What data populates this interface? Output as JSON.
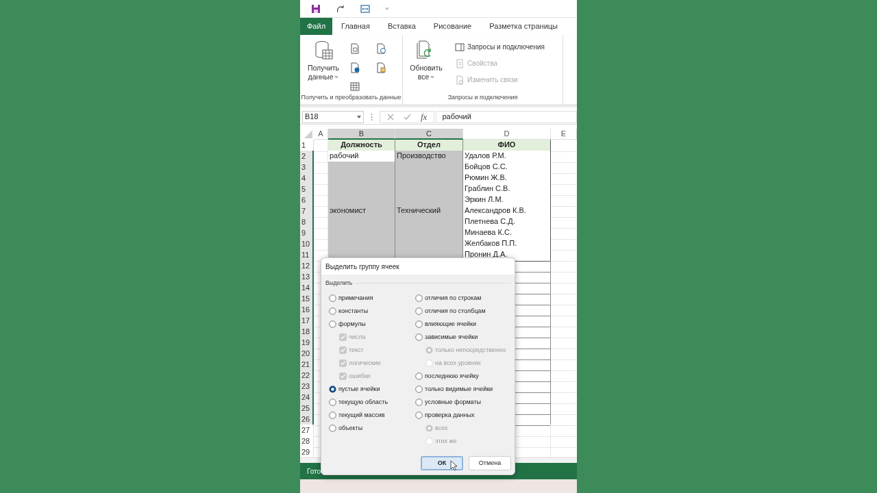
{
  "ribbon_tabs": [
    {
      "label": "Файл",
      "kind": "file"
    },
    {
      "label": "Главная",
      "kind": "tab"
    },
    {
      "label": "Вставка",
      "kind": "tab"
    },
    {
      "label": "Рисование",
      "kind": "tab"
    },
    {
      "label": "Разметка страницы",
      "kind": "tab"
    }
  ],
  "ribbon_groups": [
    {
      "label": "Получить и преобразовать данные",
      "big_button": [
        "Получить",
        "данные"
      ],
      "kind": "icons"
    },
    {
      "label": "Запросы и подключения",
      "big_button": [
        "Обновить",
        "все"
      ],
      "kind": "commands",
      "items": [
        {
          "label": "Запросы и подключения",
          "disabled": false
        },
        {
          "label": "Свойства",
          "disabled": true
        },
        {
          "label": "Изменить связи",
          "disabled": true
        }
      ]
    }
  ],
  "formula_bar": {
    "name_box": "B18",
    "fx": "fx",
    "value": "рабочий"
  },
  "sheet": {
    "columns": [
      {
        "label": "A",
        "highlighted": false
      },
      {
        "label": "B",
        "highlighted": true
      },
      {
        "label": "C",
        "highlighted": true
      },
      {
        "label": "D",
        "highlighted": false
      },
      {
        "label": "E",
        "highlighted": false
      }
    ],
    "rows": [
      {
        "number": "1",
        "highlighted": false,
        "cells": [
          {
            "text": "Должность",
            "kind": "header"
          },
          {
            "text": "Отдел",
            "kind": "header"
          },
          {
            "text": "ФИО",
            "kind": "header"
          }
        ]
      },
      {
        "number": "2",
        "highlighted": true,
        "cells": [
          {
            "text": "рабочий",
            "selected": false
          },
          {
            "text": "Производство",
            "selected": true
          },
          {
            "text": "Удалов Р.М.",
            "selected": false
          }
        ]
      },
      {
        "number": "3",
        "highlighted": true,
        "cells": [
          {
            "selected": true
          },
          {
            "selected": true
          },
          {
            "text": "Бойцов С.С.",
            "selected": false
          }
        ]
      },
      {
        "number": "4",
        "highlighted": true,
        "cells": [
          {
            "selected": true
          },
          {
            "selected": true
          },
          {
            "text": "Рюмин Ж.В.",
            "selected": false
          }
        ]
      },
      {
        "number": "5",
        "highlighted": true,
        "cells": [
          {
            "selected": true
          },
          {
            "selected": true
          },
          {
            "text": "Граблин С.В.",
            "selected": false
          }
        ]
      },
      {
        "number": "6",
        "highlighted": true,
        "cells": [
          {
            "selected": true
          },
          {
            "selected": true
          },
          {
            "text": "Эркин Л.М.",
            "selected": false
          }
        ]
      },
      {
        "number": "7",
        "highlighted": true,
        "cells": [
          {
            "text": "экономист",
            "selected": true
          },
          {
            "text": "Технический",
            "selected": true
          },
          {
            "text": "Александров К.В.",
            "selected": false
          }
        ]
      },
      {
        "number": "8",
        "highlighted": true,
        "cells": [
          {
            "selected": true
          },
          {
            "selected": true
          },
          {
            "text": "Плетнева С.Д.",
            "selected": false
          }
        ]
      },
      {
        "number": "9",
        "highlighted": true,
        "cells": [
          {
            "selected": true
          },
          {
            "selected": true
          },
          {
            "text": "Минаева К.С.",
            "selected": false
          }
        ]
      },
      {
        "number": "10",
        "highlighted": true,
        "cells": [
          {
            "selected": true
          },
          {
            "selected": true
          },
          {
            "text": "Желбаков П.П.",
            "selected": false
          }
        ]
      },
      {
        "number": "11",
        "highlighted": true,
        "cells": [
          {
            "selected": true
          },
          {
            "selected": true
          },
          {
            "text": "Пронин Д.А.",
            "selected": false
          }
        ]
      },
      {
        "number": "12",
        "highlighted": true
      },
      {
        "number": "13",
        "highlighted": true
      },
      {
        "number": "14",
        "highlighted": true
      },
      {
        "number": "15",
        "highlighted": true
      },
      {
        "number": "16",
        "highlighted": true
      },
      {
        "number": "17",
        "highlighted": true
      },
      {
        "number": "18",
        "highlighted": true
      },
      {
        "number": "19",
        "highlighted": true
      },
      {
        "number": "20",
        "highlighted": true
      },
      {
        "number": "21",
        "highlighted": true
      },
      {
        "number": "22",
        "highlighted": true
      },
      {
        "number": "23",
        "highlighted": true
      },
      {
        "number": "24",
        "highlighted": true
      },
      {
        "number": "25",
        "highlighted": true
      },
      {
        "number": "26",
        "highlighted": true
      },
      {
        "number": "27",
        "highlighted": false
      },
      {
        "number": "28",
        "highlighted": false
      },
      {
        "number": "29",
        "highlighted": false
      }
    ]
  },
  "status_bar": {
    "text": "Гото"
  },
  "dialog": {
    "title": "Выделить группу ячеек",
    "section": "Выделить",
    "left_options": [
      {
        "label": "примечания",
        "kind": "radio",
        "selected": false,
        "disabled": false
      },
      {
        "label": "константы",
        "kind": "radio",
        "selected": false,
        "disabled": false
      },
      {
        "label": "формулы",
        "kind": "radio",
        "selected": false,
        "disabled": false,
        "children": [
          {
            "label": "числа",
            "kind": "checkbox",
            "checked": true,
            "disabled": true
          },
          {
            "label": "текст",
            "kind": "checkbox",
            "checked": true,
            "disabled": true
          },
          {
            "label": "логические",
            "kind": "checkbox",
            "checked": true,
            "disabled": true
          },
          {
            "label": "ошибки",
            "kind": "checkbox",
            "checked": true,
            "disabled": true
          }
        ]
      },
      {
        "label": "пустые ячейки",
        "kind": "radio",
        "selected": true,
        "disabled": false
      },
      {
        "label": "текущую область",
        "kind": "radio",
        "selected": false,
        "disabled": false
      },
      {
        "label": "текущий массив",
        "kind": "radio",
        "selected": false,
        "disabled": false
      },
      {
        "label": "объекты",
        "kind": "radio",
        "selected": false,
        "disabled": false
      }
    ],
    "right_options": [
      {
        "label": "отличия по строкам",
        "kind": "radio",
        "selected": false,
        "disabled": false
      },
      {
        "label": "отличия по столбцам",
        "kind": "radio",
        "selected": false,
        "disabled": false
      },
      {
        "label": "влияющие ячейки",
        "kind": "radio",
        "selected": false,
        "disabled": false
      },
      {
        "label": "зависимые ячейки",
        "kind": "radio",
        "selected": false,
        "disabled": false,
        "children": [
          {
            "label": "только непосредственно",
            "kind": "radio",
            "selected": true,
            "disabled": true
          },
          {
            "label": "на всех уровнях",
            "kind": "radio",
            "selected": false,
            "disabled": true
          }
        ]
      },
      {
        "label": "последнюю ячейку",
        "kind": "radio",
        "selected": false,
        "disabled": false
      },
      {
        "label": "только видимые ячейки",
        "kind": "radio",
        "selected": false,
        "disabled": false
      },
      {
        "label": "условные форматы",
        "kind": "radio",
        "selected": false,
        "disabled": false
      },
      {
        "label": "проверка данных",
        "kind": "radio",
        "selected": false,
        "disabled": false,
        "children": [
          {
            "label": "всех",
            "kind": "radio",
            "selected": true,
            "disabled": true
          },
          {
            "label": "этих же",
            "kind": "radio",
            "selected": false,
            "disabled": true
          }
        ]
      }
    ],
    "buttons": [
      {
        "label": "ОК",
        "default": true
      },
      {
        "label": "Отмена",
        "default": false
      }
    ]
  }
}
